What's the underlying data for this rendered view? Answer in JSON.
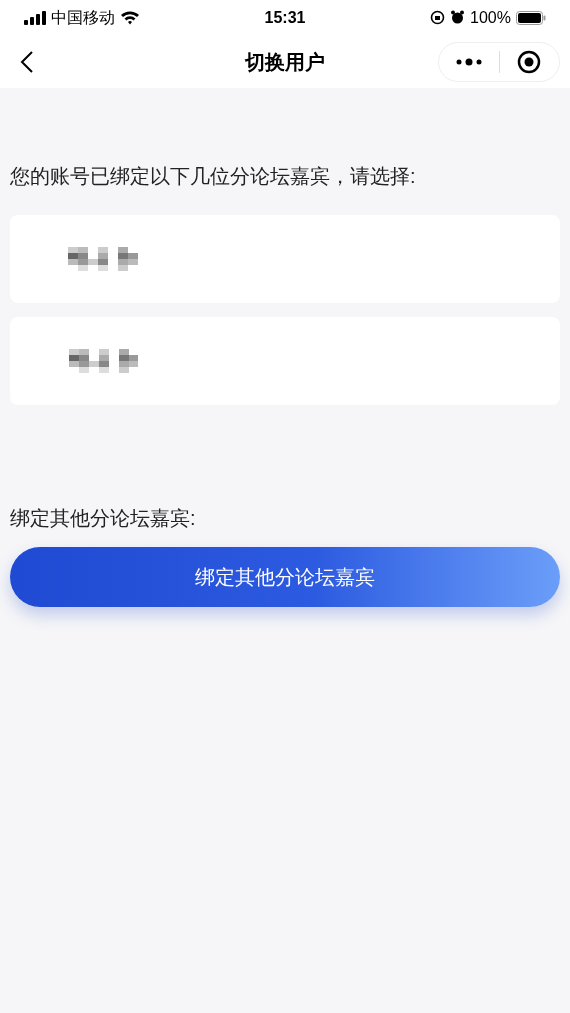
{
  "status_bar": {
    "carrier": "中国移动",
    "time": "15:31",
    "battery": "100%"
  },
  "nav": {
    "title": "切换用户"
  },
  "prompt": "您的账号已绑定以下几位分论坛嘉宾，请选择:",
  "users": [
    {
      "kind": "redacted"
    },
    {
      "kind": "redacted"
    }
  ],
  "other_label": "绑定其他分论坛嘉宾:",
  "bind_button": "绑定其他分论坛嘉宾"
}
